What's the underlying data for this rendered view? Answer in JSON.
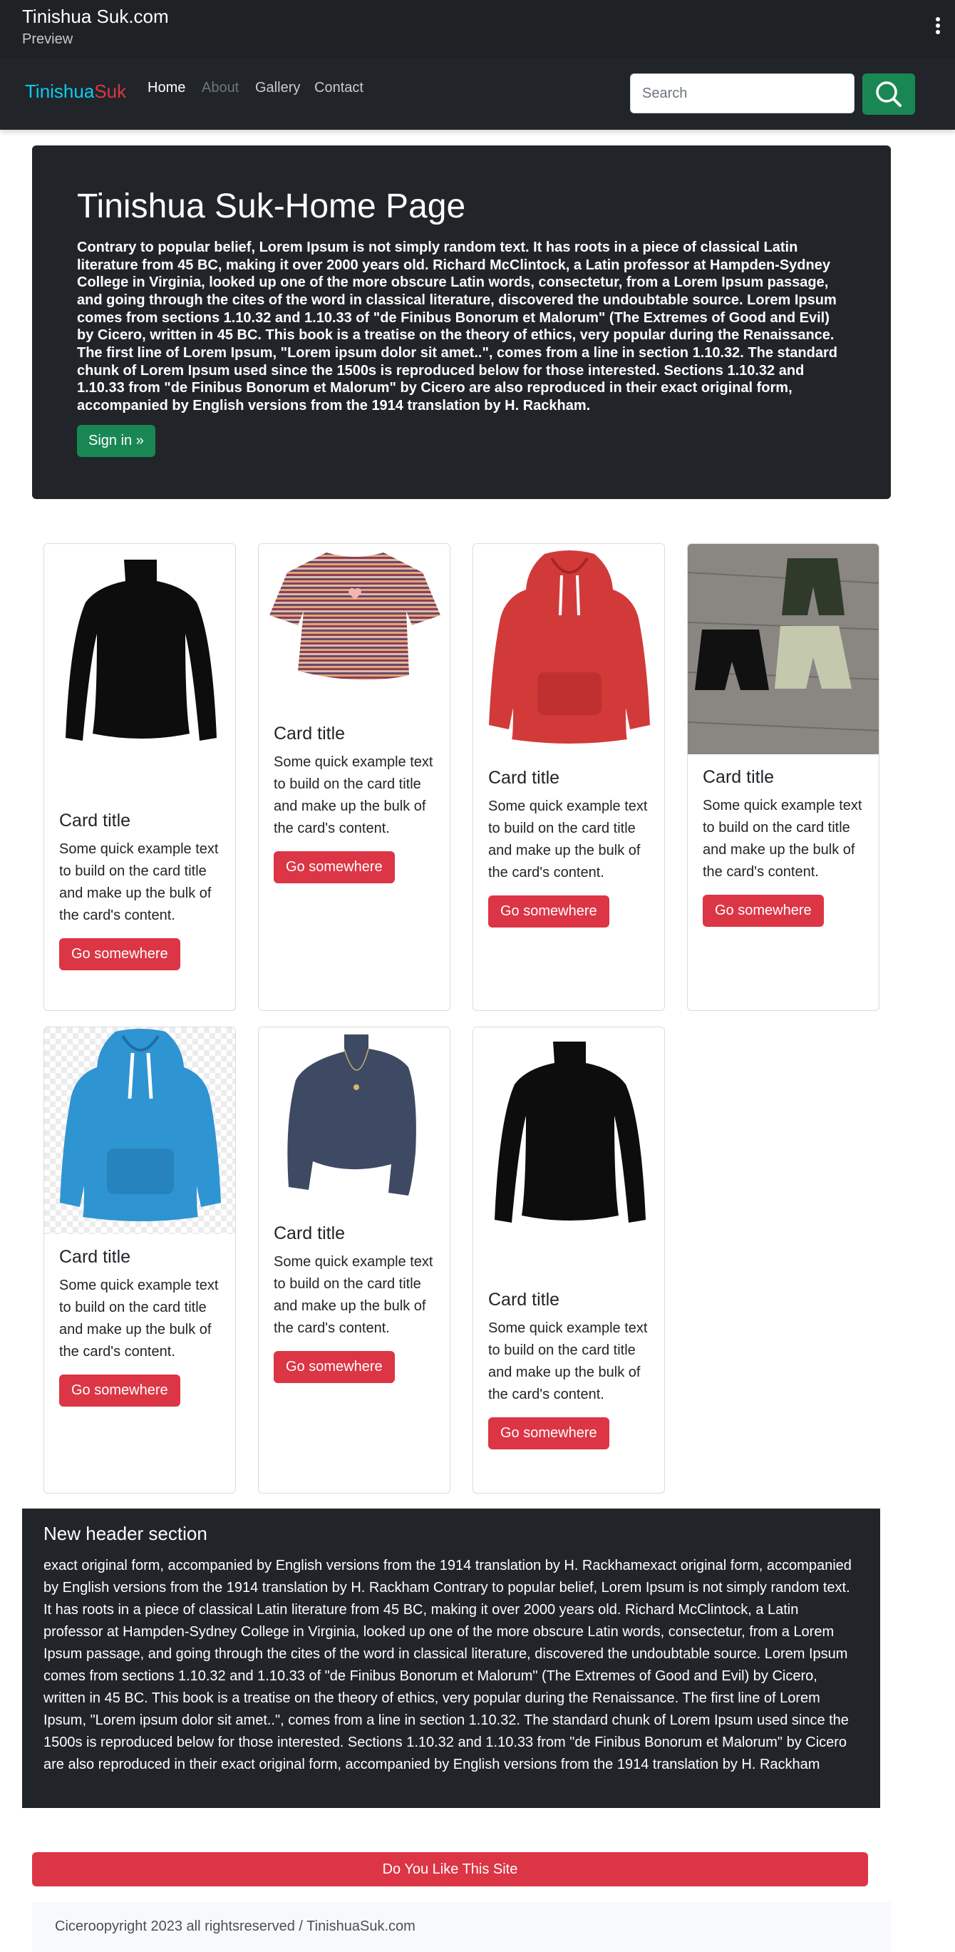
{
  "window": {
    "title": "Tinishua Suk.com",
    "subtitle": "Preview"
  },
  "navbar": {
    "brand_part1": "Tinishua",
    "brand_part2": "Suk",
    "links": [
      {
        "label": "Home"
      },
      {
        "label": "About"
      },
      {
        "label": "Gallery"
      },
      {
        "label": "Contact"
      }
    ],
    "search_placeholder": "Search",
    "search_button_icon": "search-icon"
  },
  "hero": {
    "title": "Tinishua Suk-Home Page",
    "body": "Contrary to popular belief, Lorem Ipsum is not simply random text. It has roots in a piece of classical Latin literature from 45 BC, making it over 2000 years old. Richard McClintock, a Latin professor at Hampden-Sydney College in Virginia, looked up one of the more obscure Latin words, consectetur, from a Lorem Ipsum passage, and going through the cites of the word in classical literature, discovered the undoubtable source. Lorem Ipsum comes from sections 1.10.32 and 1.10.33 of \"de Finibus Bonorum et Malorum\" (The Extremes of Good and Evil) by Cicero, written in 45 BC. This book is a treatise on the theory of ethics, very popular during the Renaissance. The first line of Lorem Ipsum, \"Lorem ipsum dolor sit amet..\", comes from a line in section 1.10.32. The standard chunk of Lorem Ipsum used since the 1500s is reproduced below for those interested. Sections 1.10.32 and 1.10.33 from \"de Finibus Bonorum et Malorum\" by Cicero are also reproduced in their exact original form, accompanied by English versions from the 1914 translation by H. Rackham.",
    "button": "Sign in »"
  },
  "cards": [
    {
      "title": "Card title",
      "text": "Some quick example text to build on the card title and make up the bulk of the card's content.",
      "button": "Go somewhere",
      "image": "black-turtleneck-crop-top"
    },
    {
      "title": "Card title",
      "text": "Some quick example text to build on the card title and make up the bulk of the card's content.",
      "button": "Go somewhere",
      "image": "striped-crop-tee"
    },
    {
      "title": "Card title",
      "text": "Some quick example text to build on the card title and make up the bulk of the card's content.",
      "button": "Go somewhere",
      "image": "red-hoodie"
    },
    {
      "title": "Card title",
      "text": "Some quick example text to build on the card title and make up the bulk of the card's content.",
      "button": "Go somewhere",
      "image": "cargo-shorts-on-wood"
    },
    {
      "title": "Card title",
      "text": "Some quick example text to build on the card title and make up the bulk of the card's content.",
      "button": "Go somewhere",
      "image": "blue-hoodie"
    },
    {
      "title": "Card title",
      "text": "Some quick example text to build on the card title and make up the bulk of the card's content.",
      "button": "Go somewhere",
      "image": "navy-knit-sweater"
    },
    {
      "title": "Card title",
      "text": "Some quick example text to build on the card title and make up the bulk of the card's content.",
      "button": "Go somewhere",
      "image": "black-turtleneck-crop-top"
    }
  ],
  "section": {
    "title": "New header section",
    "body": "exact original form, accompanied by English versions from the 1914 translation by H. Rackhamexact original form, accompanied by English versions from the 1914 translation by H. Rackham Contrary to popular belief, Lorem Ipsum is not simply random text. It has roots in a piece of classical Latin literature from 45 BC, making it over 2000 years old. Richard McClintock, a Latin professor at Hampden-Sydney College in Virginia, looked up one of the more obscure Latin words, consectetur, from a Lorem Ipsum passage, and going through the cites of the word in classical literature, discovered the undoubtable source. Lorem Ipsum comes from sections 1.10.32 and 1.10.33 of \"de Finibus Bonorum et Malorum\" (The Extremes of Good and Evil) by Cicero, written in 45 BC. This book is a treatise on the theory of ethics, very popular during the Renaissance. The first line of Lorem Ipsum, \"Lorem ipsum dolor sit amet..\", comes from a line in section 1.10.32. The standard chunk of Lorem Ipsum used since the 1500s is reproduced below for those interested. Sections 1.10.32 and 1.10.33 from \"de Finibus Bonorum et Malorum\" by Cicero are also reproduced in their exact original form, accompanied by English versions from the 1914 translation by H. Rackham"
  },
  "like_button": "Do You Like This Site",
  "footer": "Ciceroopyright 2023 all rightsreserved / TinishuaSuk.com",
  "colors": {
    "dark": "#212529",
    "green": "#198754",
    "red": "#dc3545",
    "cyan": "#0dcaf0"
  }
}
